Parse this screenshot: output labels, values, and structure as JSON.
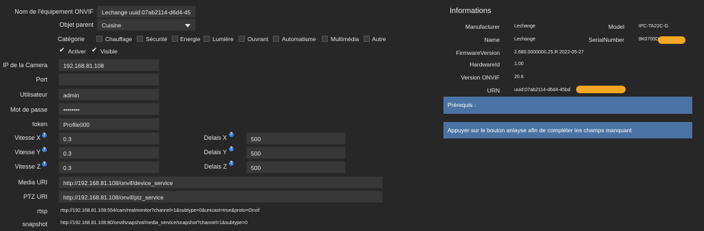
{
  "form": {
    "equipment_name": {
      "label": "Nom de l'équipement ONVIF",
      "value": "Lechange uuid:07ab2114-d6d4-45"
    },
    "parent": {
      "label": "Objet parent",
      "value": "Cuisine"
    },
    "category": {
      "label": "Catégorie",
      "options": [
        "Chauffage",
        "Sécurité",
        "Energie",
        "Lumière",
        "Ouvrant",
        "Automatisme",
        "Multimédia",
        "Autre"
      ]
    },
    "activate": {
      "label": "Activer",
      "checked": true
    },
    "visible": {
      "label": "Visible",
      "checked": true
    },
    "ip": {
      "label": "IP de la Camera",
      "value": "192.168.81.108"
    },
    "port": {
      "label": "Port",
      "value": ""
    },
    "user": {
      "label": "Utilisateur",
      "value": "admin"
    },
    "password": {
      "label": "Mot de passe",
      "value": "••••••••"
    },
    "token": {
      "label": "token",
      "value": "Profile000"
    },
    "speed_x": {
      "label": "Vitesse X",
      "value": "0.3"
    },
    "speed_y": {
      "label": "Vitesse Y",
      "value": "0.3"
    },
    "speed_z": {
      "label": "Vitesse Z",
      "value": "0.3"
    },
    "delay_x": {
      "label": "Delais X",
      "value": "500"
    },
    "delay_y": {
      "label": "Delais Y",
      "value": "500"
    },
    "delay_z": {
      "label": "Delais Z",
      "value": "500"
    },
    "media_uri": {
      "label": "Media URI",
      "value": "http://192.168.81.108/onvif/device_service"
    },
    "ptz_uri": {
      "label": "PTZ URI",
      "value": "http://192.168.81.108/onvif/ptz_service"
    },
    "rtsp": {
      "label": "rtsp",
      "value": "rtsp://192.168.81.108:554/cam/realmonitor?channel=1&subtype=0&unicast=true&proto=Onvif"
    },
    "snapshot": {
      "label": "snapshot",
      "value": "http://192.168.81.108:80/onvifsnapshot/media_service/snapshot?channel=1&subtype=0"
    },
    "help_glyph": "?"
  },
  "info": {
    "title": "Informations",
    "manufacturer": {
      "label": "Manufacturer",
      "value": "Lechange"
    },
    "model": {
      "label": "Model",
      "value": "IPC-TA22C-G"
    },
    "name": {
      "label": "Name",
      "value": "Lechange"
    },
    "serial": {
      "label": "SerialNumber",
      "value": "8K0700D"
    },
    "firmware": {
      "label": "FirmwareVersion",
      "value": "2.680.0000000.25.R 2022-05-27"
    },
    "hardware": {
      "label": "HardwareId",
      "value": "1.00"
    },
    "onvif_version": {
      "label": "Version ONVIF",
      "value": "20.6"
    },
    "urn": {
      "label": "URN",
      "value": "uuid:07ab2114-d6d4-45bd"
    },
    "prereq": "Prérequis :",
    "hint": "Appuyer sur le bouton anlayse afin de compléter les champs manquant"
  },
  "colors": {
    "background": "#272727",
    "input": "#383838",
    "info_box": "#4a73a3",
    "redaction": "#f5a623",
    "help": "#3d7fd4"
  }
}
